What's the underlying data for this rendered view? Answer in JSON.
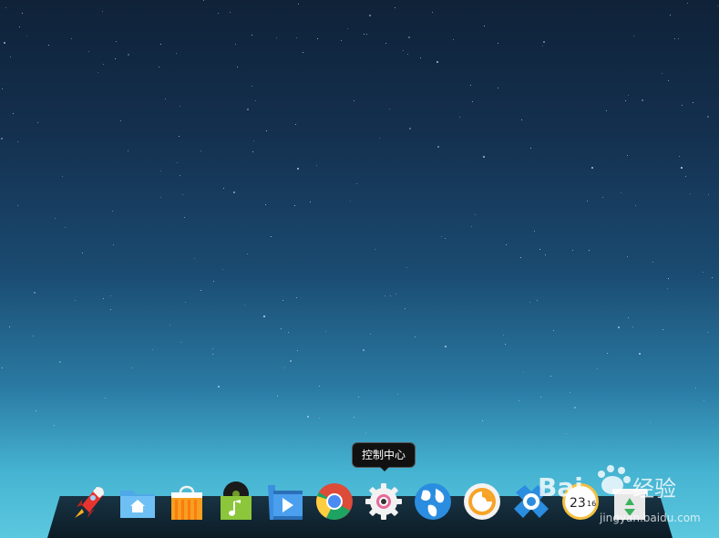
{
  "desktop": {
    "tooltip_text": "控制中心"
  },
  "dock": {
    "items": [
      {
        "name": "launcher",
        "icon": "rocket-icon"
      },
      {
        "name": "file-manager",
        "icon": "home-folder-icon"
      },
      {
        "name": "app-store",
        "icon": "shopping-bag-icon"
      },
      {
        "name": "music",
        "icon": "music-note-icon"
      },
      {
        "name": "video",
        "icon": "play-film-icon"
      },
      {
        "name": "chrome",
        "icon": "chrome-icon"
      },
      {
        "name": "control-center",
        "icon": "gear-icon"
      },
      {
        "name": "browser",
        "icon": "globe-icon"
      },
      {
        "name": "camera",
        "icon": "camera-lens-icon"
      },
      {
        "name": "screenshot",
        "icon": "scissors-icon"
      },
      {
        "name": "clock",
        "icon": "clock-icon",
        "time_hour": "23",
        "time_min": "16"
      },
      {
        "name": "trash",
        "icon": "trash-icon"
      }
    ]
  },
  "watermark": {
    "logo_text": "Bai 经验",
    "url_text": "jingyan.baidu.com"
  },
  "colors": {
    "dock_bg": "#0c1a26",
    "tooltip_bg": "#111111"
  }
}
